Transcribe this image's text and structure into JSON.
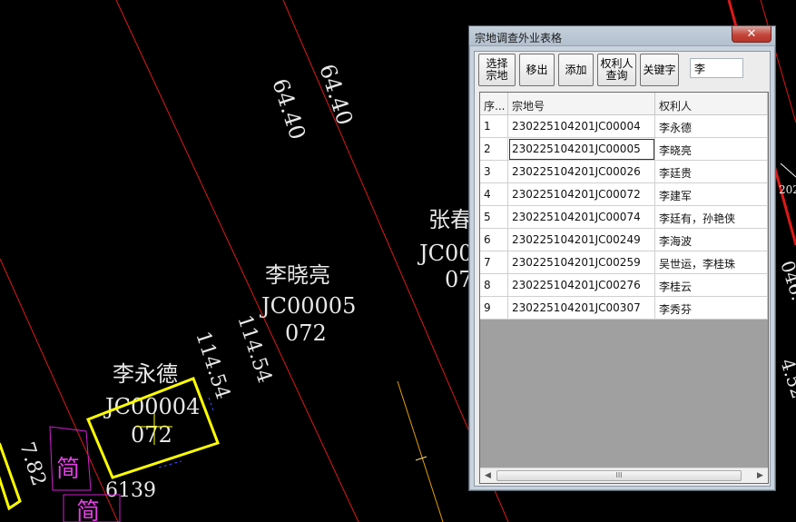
{
  "cad": {
    "dims": [
      "64.40",
      "64.40",
      "114.54",
      "114.54",
      "7.82",
      "6139",
      "046.",
      "4.52",
      "202"
    ],
    "parcels": [
      {
        "owner": "李晓亮",
        "code": "JC00005",
        "num": "072"
      },
      {
        "owner": "李永德",
        "code": "JC00004",
        "num": "072"
      },
      {
        "owner": "张春",
        "code": "JC00",
        "num": "07"
      }
    ],
    "markers": [
      "简",
      "简"
    ]
  },
  "dialog": {
    "title": "宗地调查外业表格",
    "close_label": "✕",
    "toolbar": {
      "select_parcel": [
        "选择",
        "宗地"
      ],
      "remove": "移出",
      "add": "添加",
      "owner_query": [
        "权利人",
        "查询"
      ],
      "keyword": "关键字",
      "keyword_value": "李"
    },
    "table": {
      "columns": [
        "序...",
        "宗地号",
        "权利人"
      ],
      "rows": [
        {
          "idx": "1",
          "code": "230225104201JC00004",
          "owner": "李永德"
        },
        {
          "idx": "2",
          "code": "230225104201JC00005",
          "owner": "李晓亮"
        },
        {
          "idx": "3",
          "code": "230225104201JC00026",
          "owner": "李廷贵"
        },
        {
          "idx": "4",
          "code": "230225104201JC00072",
          "owner": "李建军"
        },
        {
          "idx": "5",
          "code": "230225104201JC00074",
          "owner": "李廷有，孙艳侠"
        },
        {
          "idx": "6",
          "code": "230225104201JC00249",
          "owner": "李海波"
        },
        {
          "idx": "7",
          "code": "230225104201JC00259",
          "owner": "吴世运，李桂珠"
        },
        {
          "idx": "8",
          "code": "230225104201JC00276",
          "owner": "李桂云"
        },
        {
          "idx": "9",
          "code": "230225104201JC00307",
          "owner": "李秀芬"
        }
      ]
    },
    "scrollbar_grip": "III"
  }
}
